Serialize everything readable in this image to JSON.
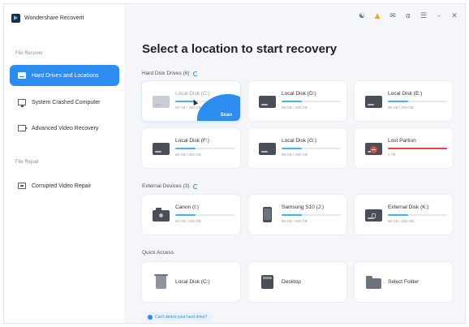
{
  "app": {
    "name": "Wondershare Recoverit"
  },
  "sidebar": {
    "sections": [
      {
        "label": "File Recover"
      },
      {
        "label": "File Repair"
      }
    ],
    "items": [
      {
        "label": "Hard Drives and Locations",
        "active": true,
        "icon": "hard-drive-icon"
      },
      {
        "label": "System Crashed Computer",
        "icon": "monitor-icon"
      },
      {
        "label": "Advanced Video Recovery",
        "icon": "video-icon"
      },
      {
        "label": "Corrupted Video Repair",
        "icon": "repair-icon"
      }
    ]
  },
  "topbar": {
    "icons": [
      "user-icon",
      "cart-icon",
      "mail-icon",
      "headset-icon",
      "menu-icon",
      "minimize-icon",
      "close-icon"
    ]
  },
  "main": {
    "title": "Select a location to start recovery",
    "hard_disk_drives": {
      "label": "Hard Disk Drives (6)",
      "items": [
        {
          "name": "Local Disk (C:)",
          "size": "86 GB / 250 GB",
          "fill": 0.34,
          "selected": true,
          "action": "Scan"
        },
        {
          "name": "Local Disk (D:)",
          "size": "86 GB / 250 GB",
          "fill": 0.34
        },
        {
          "name": "Local Disk (E:)",
          "size": "86 GB / 250 GB",
          "fill": 0.34
        },
        {
          "name": "Local Disk (F:)",
          "size": "86 GB / 250 GB",
          "fill": 0.34
        },
        {
          "name": "Local Disk (G:)",
          "size": "86 GB / 250 GB",
          "fill": 0.34
        },
        {
          "name": "Lost Partion",
          "size": "1 TB",
          "fill": 1.0,
          "lost": true
        }
      ]
    },
    "external_devices": {
      "label": "External Devices (3)",
      "items": [
        {
          "name": "Canon (I:)",
          "size": "86 GB / 250 GB",
          "fill": 0.34,
          "icon": "camera-icon"
        },
        {
          "name": "Samsung S10   (J:)",
          "size": "86 GB / 250 GB",
          "fill": 0.34,
          "icon": "phone-icon"
        },
        {
          "name": "External Disk (K:)",
          "size": "86 GB / 250 GB",
          "fill": 0.34,
          "icon": "external-disk-icon"
        }
      ]
    },
    "quick_access": {
      "label": "Quick Access",
      "items": [
        {
          "name": "Local Disk (C:)",
          "icon": "trash-icon"
        },
        {
          "name": "Desktop",
          "icon": "desktop-icon"
        },
        {
          "name": "Select Folder",
          "icon": "folder-icon"
        }
      ]
    },
    "help_link": "Can't detect your hard drive?"
  },
  "colors": {
    "accent": "#2d8cf0",
    "progress": "#3fb6e8",
    "danger": "#e8483c"
  }
}
